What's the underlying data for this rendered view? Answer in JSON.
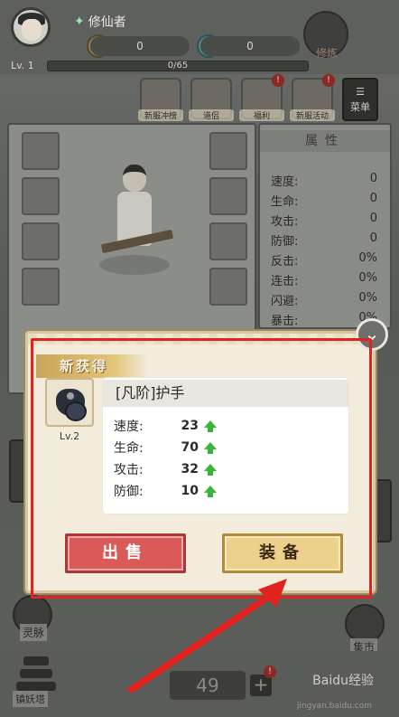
{
  "player": {
    "name": "修仙者",
    "level": "Lv. 1",
    "exp": "0/65",
    "spirit_stones": "0",
    "jade": "0"
  },
  "top_icon_label": "修炼",
  "menu": [
    {
      "label": "新服冲榜",
      "badge": ""
    },
    {
      "label": "道侣",
      "badge": ""
    },
    {
      "label": "福利",
      "badge": "!"
    },
    {
      "label": "新服活动",
      "badge": "!"
    }
  ],
  "menu_more_label": "菜单",
  "attributes": {
    "title": "属性",
    "rows": [
      {
        "k": "速度:",
        "v": "0"
      },
      {
        "k": "生命:",
        "v": "0"
      },
      {
        "k": "攻击:",
        "v": "0"
      },
      {
        "k": "防御:",
        "v": "0"
      },
      {
        "k": "反击:",
        "v": "0%"
      },
      {
        "k": "连击:",
        "v": "0%"
      },
      {
        "k": "闪避:",
        "v": "0%"
      },
      {
        "k": "暴击:",
        "v": "0%"
      }
    ]
  },
  "side_labels": {
    "left": "灵脉",
    "right": "集市"
  },
  "dialog": {
    "banner": "新获得",
    "item_name": "[凡阶]护手",
    "item_level": "Lv.2",
    "stats": [
      {
        "k": "速度:",
        "v": "23"
      },
      {
        "k": "生命:",
        "v": "70"
      },
      {
        "k": "攻击:",
        "v": "32"
      },
      {
        "k": "防御:",
        "v": "10"
      }
    ],
    "sell_label": "出售",
    "equip_label": "装备"
  },
  "bottom": {
    "count": "49",
    "plus": "+",
    "badge": "!",
    "left_label": "镇妖塔"
  },
  "watermark": {
    "brand": "Baidu经验",
    "url": "jingyan.baidu.com"
  },
  "colors": {
    "highlight": "#e1231f",
    "arrow": "#e1231f",
    "stat_up": "#3cb437"
  }
}
